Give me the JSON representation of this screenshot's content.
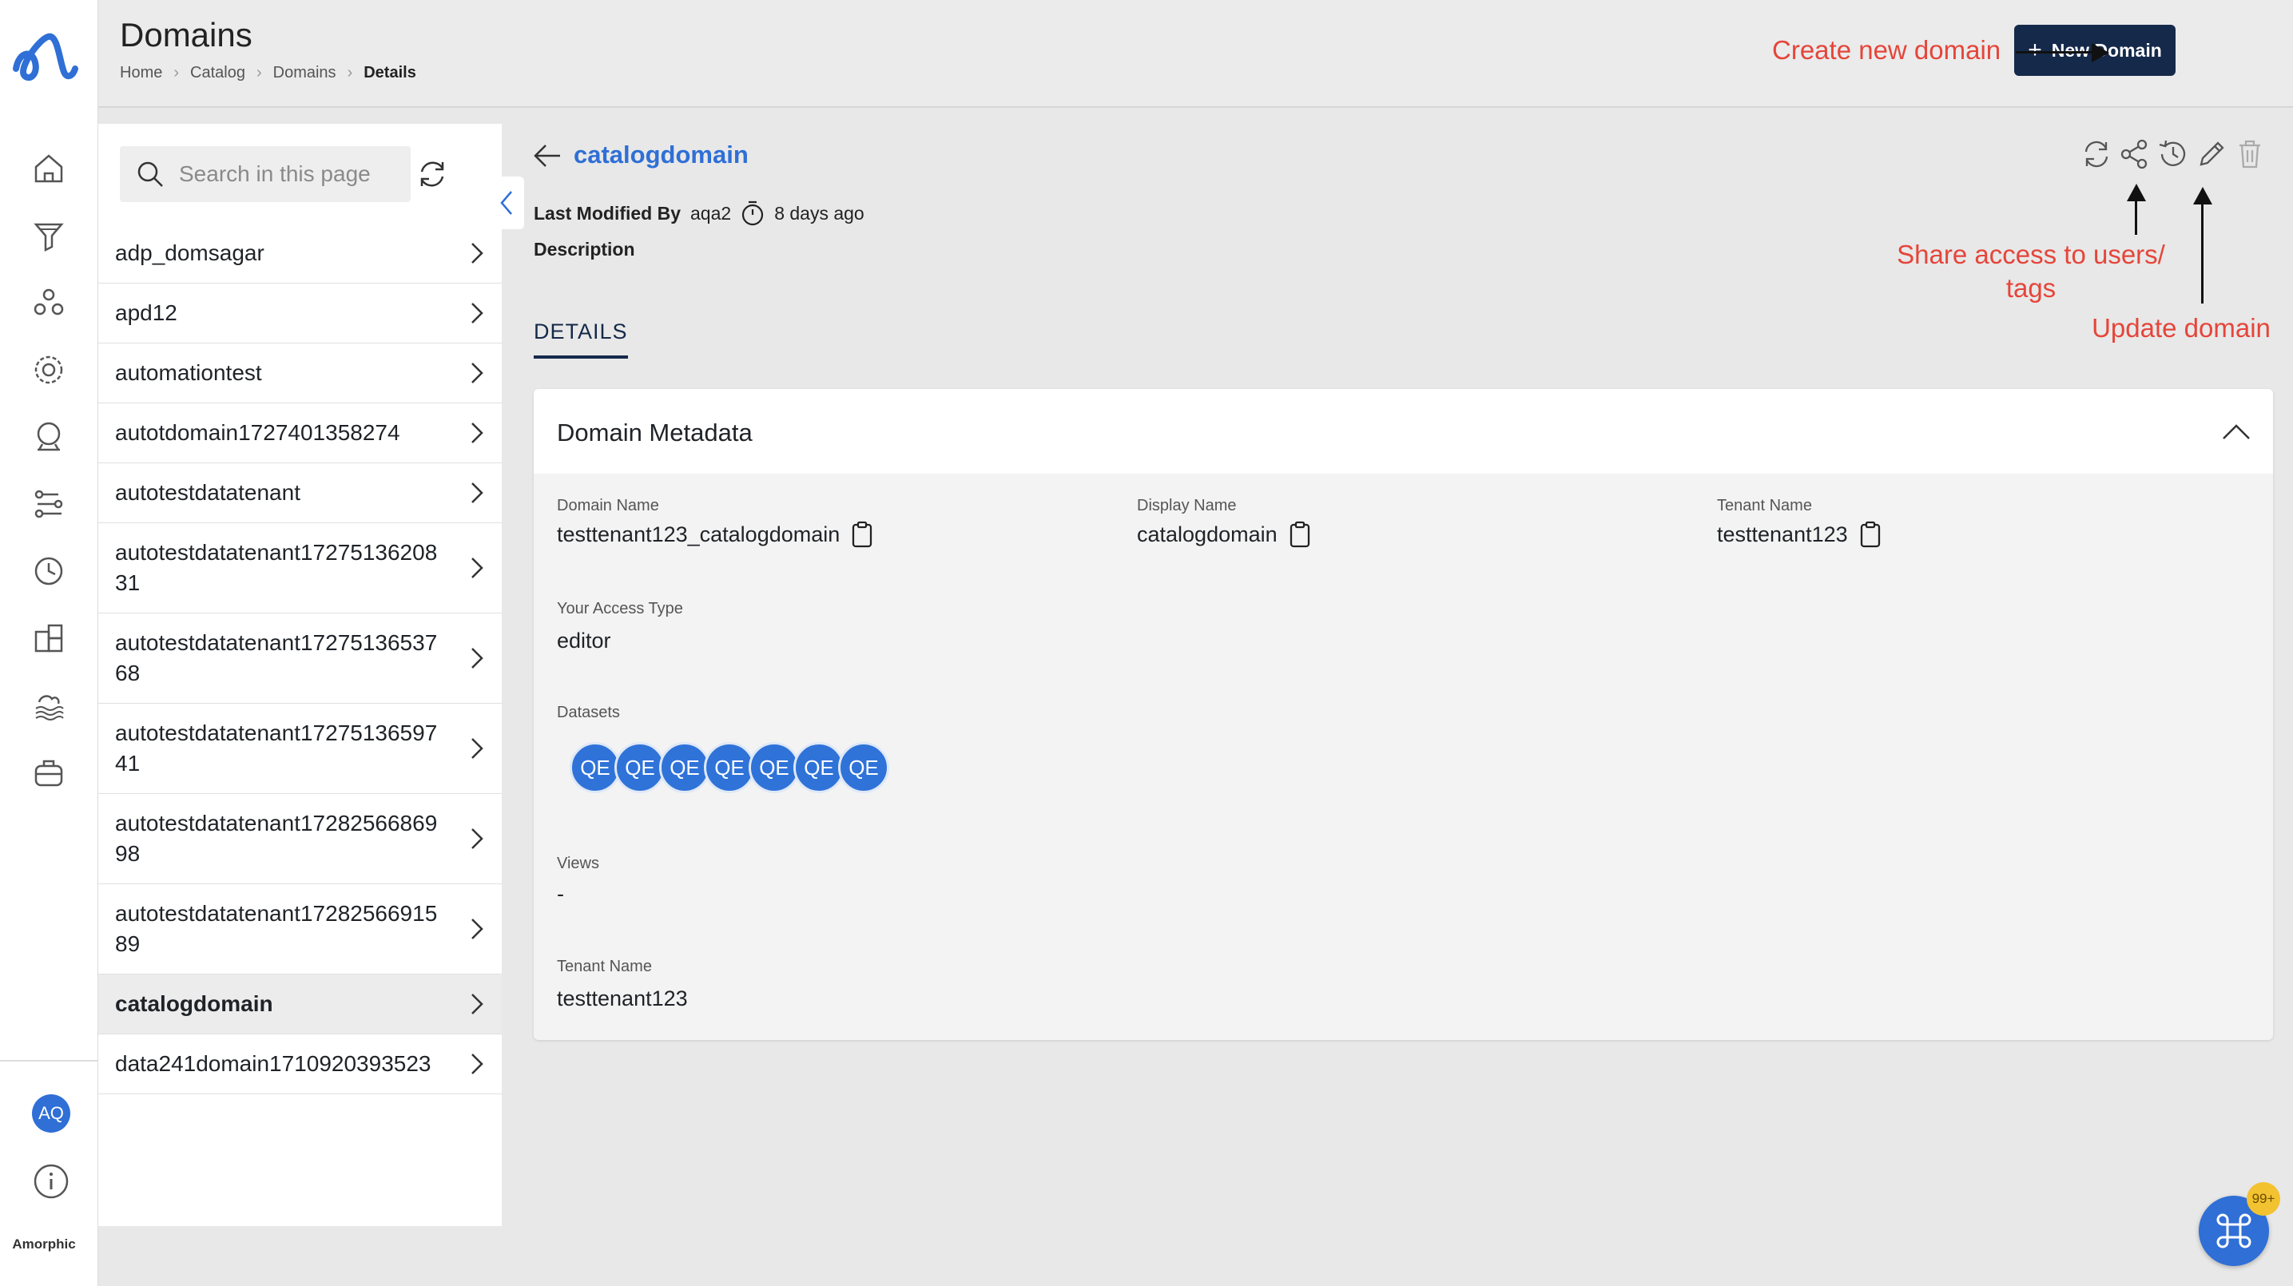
{
  "brand": {
    "name": "Amorphic",
    "user_initials": "AQ"
  },
  "header": {
    "title": "Domains",
    "breadcrumbs": [
      "Home",
      "Catalog",
      "Domains",
      "Details"
    ],
    "new_domain_label": "New Domain"
  },
  "annotations": {
    "create": "Create new domain",
    "share": "Share access to users/ tags",
    "update": "Update domain"
  },
  "list": {
    "search_placeholder": "Search in this page",
    "items": [
      "adp_domsagar",
      "apd12",
      "automationtest",
      "autotdomain1727401358274",
      "autotestdatatenant",
      "autotestdatatenant1727513620831",
      "autotestdatatenant1727513653768",
      "autotestdatatenant1727513659741",
      "autotestdatatenant1728256686998",
      "autotestdatatenant1728256691589",
      "catalogdomain",
      "data241domain1710920393523"
    ],
    "selected_index": 10
  },
  "detail": {
    "title": "catalogdomain",
    "last_modified_label": "Last Modified By",
    "last_modified_user": "aqa2",
    "last_modified_time": "8 days ago",
    "description_label": "Description",
    "tabs": [
      "DETAILS"
    ]
  },
  "metadata": {
    "title": "Domain Metadata",
    "domain_name_label": "Domain Name",
    "domain_name": "testtenant123_catalogdomain",
    "display_name_label": "Display Name",
    "display_name": "catalogdomain",
    "tenant_name_label": "Tenant Name",
    "tenant_name": "testtenant123",
    "access_type_label": "Your Access Type",
    "access_type": "editor",
    "datasets_label": "Datasets",
    "datasets": [
      "QE",
      "QE",
      "QE",
      "QE",
      "QE",
      "QE",
      "QE"
    ],
    "views_label": "Views",
    "views": "-",
    "tenant_name_label_2": "Tenant Name",
    "tenant_name_2": "testtenant123"
  },
  "cmd_badge": "99+",
  "colors": {
    "accent": "#2f6fd6",
    "primary_button": "#15294a",
    "annotation": "#e5453a"
  }
}
